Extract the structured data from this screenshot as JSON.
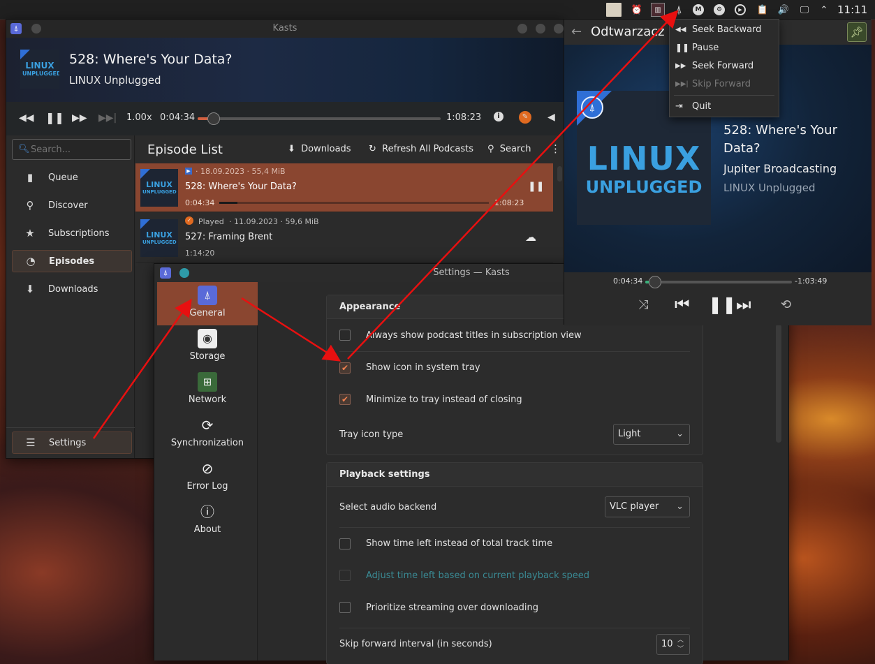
{
  "panel": {
    "clock": "11:11"
  },
  "kasts": {
    "window_title": "Kasts",
    "now_playing": {
      "title": "528: Where's Your Data?",
      "podcast": "LINUX Unplugged"
    },
    "player_bar": {
      "speed": "1.00x",
      "position": "0:04:34",
      "duration": "1:08:23",
      "progress": 0.067
    },
    "search_placeholder": "Search...",
    "nav": [
      {
        "label": "Queue",
        "icon": "file-icon"
      },
      {
        "label": "Discover",
        "icon": "search-icon"
      },
      {
        "label": "Subscriptions",
        "icon": "star-icon"
      },
      {
        "label": "Episodes",
        "icon": "rss-icon"
      },
      {
        "label": "Downloads",
        "icon": "download-icon"
      }
    ],
    "settings_nav": "Settings",
    "episode_list": {
      "title": "Episode List",
      "actions": {
        "downloads": "Downloads",
        "refresh": "Refresh All Podcasts",
        "search": "Search"
      },
      "episodes": [
        {
          "meta": "· 18.09.2023 · 55,4 MiB",
          "title": "528: Where's Your Data?",
          "time": "0:04:34",
          "remaining": "1:08:23",
          "progress": 0.067
        },
        {
          "status": "Played",
          "meta": "· 11.09.2023 · 59,6 MiB",
          "title": "527: Framing Brent",
          "time": "1:14:20"
        }
      ]
    },
    "thumb_logo": {
      "line1": "LINUX",
      "line2": "UNPLUGGED"
    }
  },
  "settings": {
    "window_title": "Settings — Kasts",
    "nav": [
      {
        "label": "General",
        "icon": "kasts-icon"
      },
      {
        "label": "Storage",
        "icon": "storage-icon"
      },
      {
        "label": "Network",
        "icon": "network-icon"
      },
      {
        "label": "Synchronization",
        "icon": "sync-icon"
      },
      {
        "label": "Error Log",
        "icon": "error-log-icon"
      },
      {
        "label": "About",
        "icon": "info-icon"
      }
    ],
    "appearance": {
      "heading": "Appearance",
      "always_show_titles": {
        "label": "Always show podcast titles in subscription view",
        "checked": false
      },
      "show_tray_icon": {
        "label": "Show icon in system tray",
        "checked": true
      },
      "minimize_to_tray": {
        "label": "Minimize to tray instead of closing",
        "checked": true
      },
      "tray_icon_type": {
        "label": "Tray icon type",
        "value": "Light"
      }
    },
    "playback": {
      "heading": "Playback settings",
      "audio_backend": {
        "label": "Select audio backend",
        "value": "VLC player"
      },
      "show_time_left": {
        "label": "Show time left instead of total track time",
        "checked": false
      },
      "adjust_time_left": {
        "label": "Adjust time left based on current playback speed",
        "checked": false
      },
      "prioritize_streaming": {
        "label": "Prioritize streaming over downloading",
        "checked": false
      },
      "skip_forward": {
        "label": "Skip forward interval (in seconds)",
        "value": "10"
      }
    }
  },
  "player": {
    "title": "Odtwarzacz n",
    "episode_title_line1": "528: Where's Your",
    "episode_title_line2": "Data?",
    "author": "Jupiter Broadcasting",
    "podcast": "LINUX Unplugged",
    "position": "0:04:34",
    "remaining": "-1:03:49",
    "progress": 0.067,
    "art_logo": {
      "line1": "LINUX",
      "line2": "UNPLUGGED"
    }
  },
  "tray_menu": {
    "items": [
      {
        "label": "Seek Backward",
        "icon": "seek-backward-icon",
        "enabled": true
      },
      {
        "label": "Pause",
        "icon": "pause-icon",
        "enabled": true
      },
      {
        "label": "Seek Forward",
        "icon": "seek-forward-icon",
        "enabled": true
      },
      {
        "label": "Skip Forward",
        "icon": "skip-forward-icon",
        "enabled": false
      },
      {
        "label": "Quit",
        "icon": "quit-icon",
        "enabled": true
      }
    ]
  },
  "colors": {
    "accent": "#8a4630",
    "annotation_arrow": "#e81010",
    "logo_blue": "#3aa0e0"
  }
}
